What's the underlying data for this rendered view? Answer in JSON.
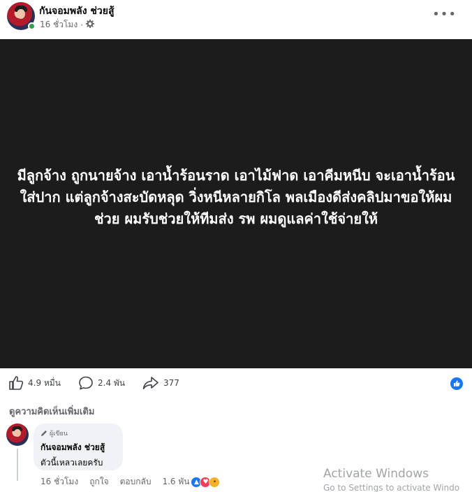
{
  "post": {
    "page_name": "กันจอมพลัง ช่วยสู้",
    "time": "16 ชั่วโมง",
    "audience_icon": "gear-icon",
    "more_icon": "more-horizontal-icon",
    "more_glyph": "•••"
  },
  "media": {
    "text": "มีลูกจ้าง ถูกนายจ้าง เอาน้ำร้อนราด เอาไม้ฟาด เอาคีมหนีบ จะเอาน้ำร้อนใส่ปาก แต่ลูกจ้างสะบัดหลุด วิ่งหนีหลายกิโล พลเมืองดีส่งคลิปมาขอให้ผมช่วย ผมรับช่วยให้ทีมส่ง รพ ผมดูแลค่าใช้จ่ายให้",
    "background": "#1c1c1c"
  },
  "stats": {
    "likes": "4.9 หมื่น",
    "comments": "2.4 พัน",
    "shares": "377"
  },
  "comments_section": {
    "more_comments_label": "ดูความคิดเห็นเพิ่มเติม",
    "comment": {
      "badge": "ผู้เขียน",
      "author": "กันจอมพลัง ช่วยสู้",
      "text": "ตัวนี้เหลวเลยครับ",
      "time": "16 ชั่วโมง",
      "like_action": "ถูกใจ",
      "reply_action": "ตอบกลับ",
      "reaction_count": "1.6 พัน"
    }
  },
  "watermark": {
    "line1": "Activate Windows",
    "line2": "Go to Settings to activate Windo"
  },
  "colors": {
    "accent": "#1877f2",
    "online": "#31a24c",
    "secondary_text": "#65676b"
  }
}
